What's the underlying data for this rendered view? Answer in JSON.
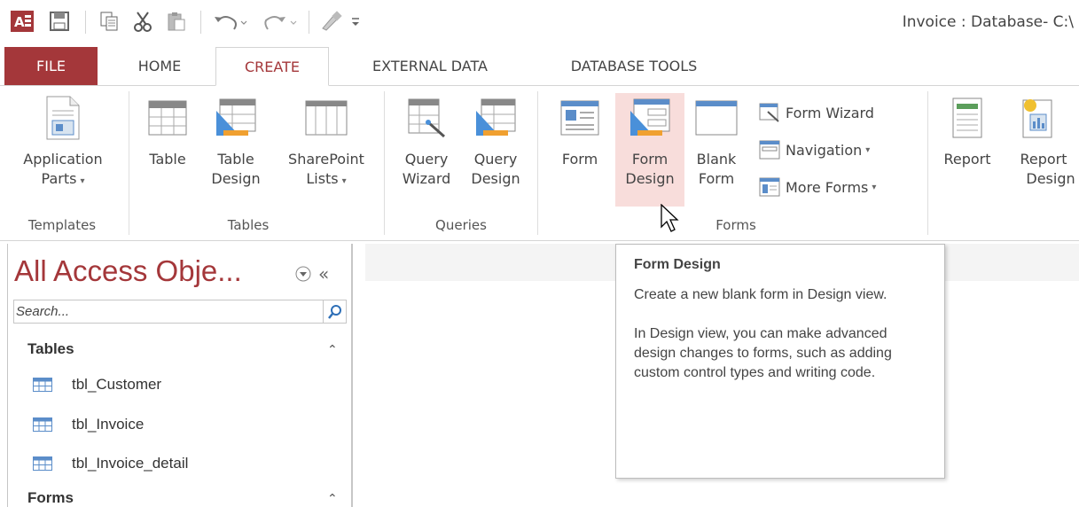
{
  "title_bar": {
    "title": "Invoice : Database- C:\\"
  },
  "quick_access": {
    "icons": [
      "access-logo-icon",
      "save-icon",
      "copy-icon",
      "cut-icon",
      "paste-icon",
      "undo-icon",
      "redo-icon",
      "format-painter-icon",
      "customize-icon"
    ]
  },
  "tabs": [
    {
      "label": "FILE"
    },
    {
      "label": "HOME"
    },
    {
      "label": "CREATE"
    },
    {
      "label": "EXTERNAL DATA"
    },
    {
      "label": "DATABASE TOOLS"
    }
  ],
  "active_tab": "CREATE",
  "ribbon": {
    "templates": {
      "label": "Templates",
      "application_parts": {
        "line1": "Application",
        "line2": "Parts"
      }
    },
    "tables": {
      "label": "Tables",
      "table": {
        "line1": "Table"
      },
      "table_design": {
        "line1": "Table",
        "line2": "Design"
      },
      "sharepoint_lists": {
        "line1": "SharePoint",
        "line2": "Lists"
      }
    },
    "queries": {
      "label": "Queries",
      "query_wizard": {
        "line1": "Query",
        "line2": "Wizard"
      },
      "query_design": {
        "line1": "Query",
        "line2": "Design"
      }
    },
    "forms": {
      "label": "Forms",
      "form": {
        "line1": "Form"
      },
      "form_design": {
        "line1": "Form",
        "line2": "Design"
      },
      "blank_form": {
        "line1": "Blank",
        "line2": "Form"
      },
      "form_wizard": "Form Wizard",
      "navigation": "Navigation",
      "more_forms": "More Forms"
    },
    "reports": {
      "report": {
        "line1": "Report"
      },
      "report_design": {
        "line1": "Report",
        "line2": "Design"
      }
    }
  },
  "nav_pane": {
    "title": "All Access Obje...",
    "search_placeholder": "Search...",
    "groups": [
      {
        "label": "Tables",
        "items": [
          "tbl_Customer",
          "tbl_Invoice",
          "tbl_Invoice_detail"
        ]
      },
      {
        "label": "Forms",
        "items": []
      }
    ]
  },
  "tooltip": {
    "title": "Form Design",
    "line1": "Create a new blank form in Design view.",
    "line2": "In Design view, you can make advanced design changes to forms, such as adding custom control types and writing code."
  },
  "colors": {
    "accent": "#a4373a",
    "hover": "#f8dddb",
    "table_blue": "#5b8dc9"
  }
}
